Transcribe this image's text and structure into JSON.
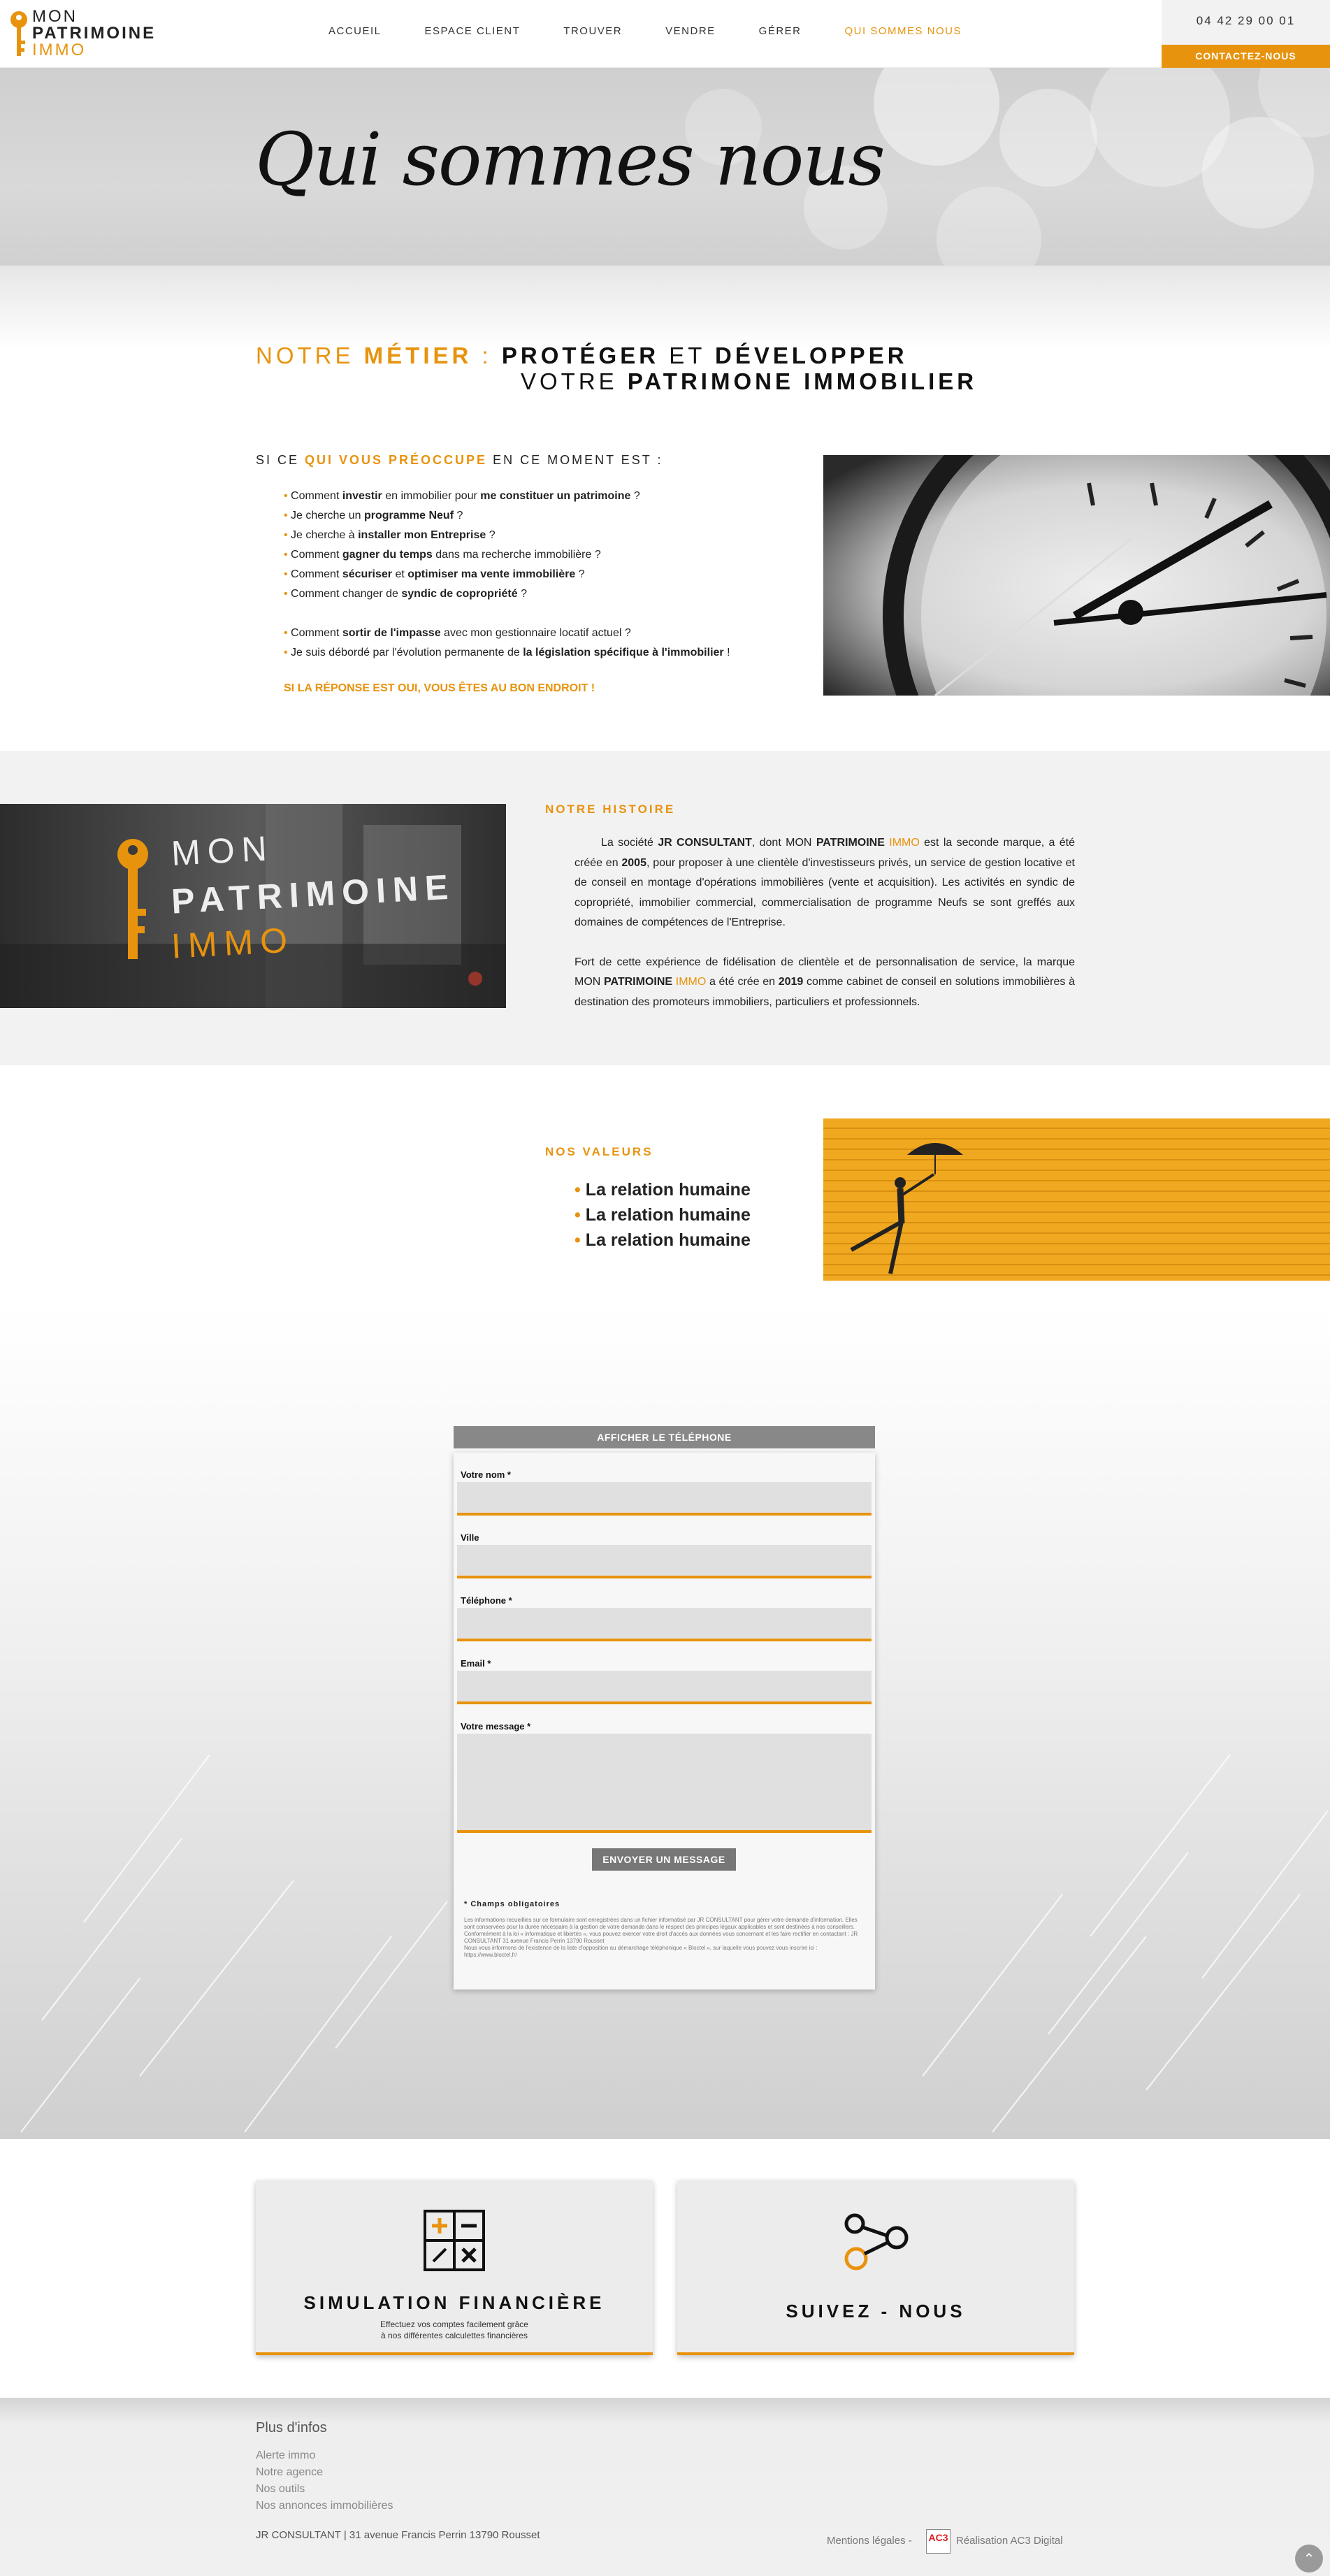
{
  "header": {
    "logo": {
      "line1": "MON",
      "line2": "PATRIMOINE",
      "line3": "IMMO"
    },
    "nav": [
      "ACCUEIL",
      "ESPACE CLIENT",
      "TROUVER",
      "VENDRE",
      "GÉRER",
      "QUI SOMMES NOUS"
    ],
    "active_nav": "QUI SOMMES NOUS",
    "phone": "04 42 29 00 01",
    "contact_button": "CONTACTEZ-NOUS"
  },
  "hero": {
    "title": "Qui sommes nous"
  },
  "metier": {
    "part1": "NOTRE",
    "part2": "MÉTIER",
    "sep": ":",
    "part3": "PROTÉGER",
    "part4": "ET",
    "part5": "DÉVELOPPER",
    "line2a": "VOTRE",
    "line2b": "PATRIMONE IMMOBILIER"
  },
  "preoccupe": {
    "title_a": "SI CE",
    "title_b": "QUI VOUS PRÉOCCUPE",
    "title_c": "EN CE MOMENT EST :",
    "items": [
      [
        "Comment ",
        "investir",
        " en immobilier pour ",
        "me constituer un patrimoine",
        " ?"
      ],
      [
        "Je cherche un ",
        "programme Neuf",
        " ?"
      ],
      [
        "Je cherche à ",
        "installer mon Entreprise",
        " ?"
      ],
      [
        "Comment ",
        "gagner du temps",
        " dans ma recherche immobilière ?"
      ],
      [
        "Comment ",
        "sécuriser",
        " et ",
        "optimiser ma vente immobilière",
        " ?"
      ],
      [
        "Comment changer de ",
        "syndic de copropriété",
        " ?"
      ],
      [
        "Comment ",
        "sortir de l'impasse",
        " avec mon gestionnaire locatif actuel ?"
      ],
      [
        "Je suis débordé par l'évolution permanente de ",
        "la législation spécifique à l'immobilier",
        " !"
      ]
    ],
    "cta": "SI LA RÉPONSE EST OUI, VOUS ÊTES AU BON ENDROIT !"
  },
  "histoire": {
    "title": "NOTRE HISTOIRE",
    "p1": [
      "La société ",
      "JR CONSULTANT",
      ", dont MON ",
      "PATRIMOINE",
      " ",
      "IMMO",
      " est la seconde marque, a été créée en ",
      "2005",
      ", pour proposer à une clientèle d'investisseurs privés, un service de gestion locative et de conseil en montage d'opérations immobilières (vente et acquisition). Les activités en syndic de copropriété, immobilier commercial, commercialisation de programme Neufs se sont greffés aux domaines de compétences de l'Entreprise."
    ],
    "p2": [
      "Fort de cette expérience de fidélisation de clientèle et de personnalisation de service, la marque MON ",
      "PATRIMOINE",
      " ",
      "IMMO",
      " a été crée en ",
      "2019",
      " comme cabinet de conseil en solutions immobilières à destination des promoteurs immobiliers, particuliers et professionnels."
    ]
  },
  "valeurs": {
    "title": "NOS VALEURS",
    "items": [
      "La relation humaine",
      "La relation humaine",
      "La relation humaine"
    ]
  },
  "form": {
    "tel_button": "AFFICHER LE TÉLÉPHONE",
    "fields": [
      {
        "label": "Votre nom *"
      },
      {
        "label": "Ville"
      },
      {
        "label": "Téléphone *"
      },
      {
        "label": "Email *"
      },
      {
        "label": "Votre message *"
      }
    ],
    "submit": "ENVOYER UN MESSAGE",
    "required_note": "* Champs obligatoires",
    "legal": "Les informations recueillies sur ce formulaire sont enregistrées dans un fichier informatisé par JR CONSULTANT pour gérer votre demande d'information. Elles sont conservées pour la durée nécessaire à la gestion de votre demande dans le respect des principes légaux applicables et sont destinées à nos conseillers. Conformément à la loi « informatique et libertés », vous pouvez exercer votre droit d'accès aux données vous concernant et les faire rectifier en contactant : JR CONSULTANT 31 avenue Francis Perrin 13790 Rousset\nNous vous informons de l'existence de la liste d'opposition au démarchage téléphonique « Bloctel », sur laquelle vous pouvez vous inscrire ici : https://www.bloctel.fr/"
  },
  "cards": [
    {
      "title": "SIMULATION FINANCIÈRE",
      "sub1": "Effectuez vos comptes facilement grâce",
      "sub2": "à nos différentes calculettes financières",
      "icon": "calculator-icon"
    },
    {
      "title": "SUIVEZ - NOUS",
      "icon": "share-icon"
    }
  ],
  "footer": {
    "title": "Plus d'infos",
    "links": [
      "Alerte immo",
      "Notre agence",
      "Nos outils",
      "Nos annonces immobilières"
    ],
    "address": "JR CONSULTANT | 31 avenue Francis Perrin 13790 Rousset",
    "legal": "Mentions légales -",
    "ac3": "AC3",
    "realisation": "Réalisation AC3 Digital"
  },
  "colors": {
    "accent": "#e8930e",
    "dark": "#111111",
    "grey": "#888888"
  }
}
